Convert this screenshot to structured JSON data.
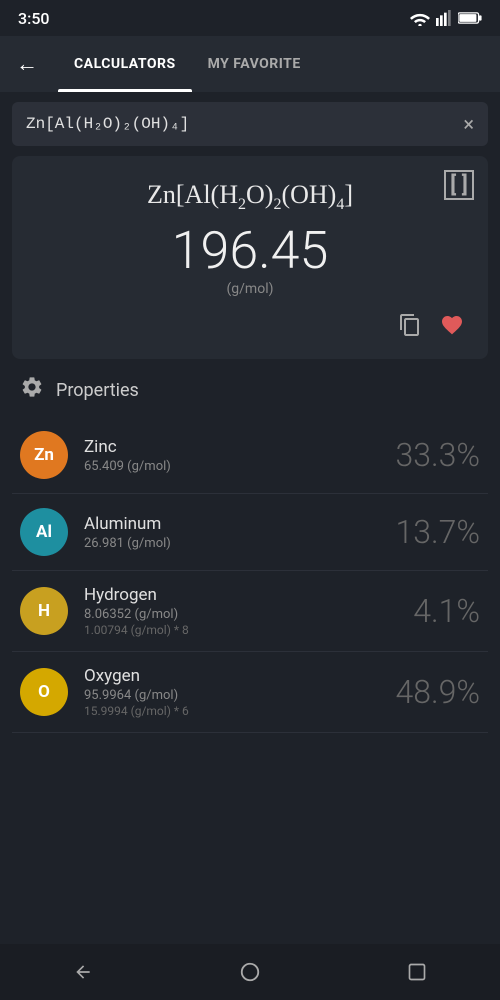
{
  "statusBar": {
    "time": "3:50"
  },
  "nav": {
    "tab1": "CALCULATORS",
    "tab2": "MY FAVORITE"
  },
  "searchBar": {
    "formula": "Zn[Al(H₂O)₂(OH)₄]",
    "clearLabel": "×"
  },
  "result": {
    "formulaHtml": "Zn[Al(H₂O)₂(OH)₄]",
    "molarMass": "196.45",
    "unit": "(g/mol)",
    "bracketLabel": "[ ]"
  },
  "properties": {
    "title": "Properties"
  },
  "elements": [
    {
      "symbol": "Zn",
      "color": "#e07820",
      "name": "Zinc",
      "mass": "65.409 (g/mol)",
      "detail": "",
      "percent": "33.3%"
    },
    {
      "symbol": "Al",
      "color": "#1e8fa0",
      "name": "Aluminum",
      "mass": "26.981 (g/mol)",
      "detail": "",
      "percent": "13.7%"
    },
    {
      "symbol": "H",
      "color": "#c8a020",
      "name": "Hydrogen",
      "mass": "8.06352 (g/mol)",
      "detail": "1.00794 (g/mol) * 8",
      "percent": "4.1%"
    },
    {
      "symbol": "O",
      "color": "#d4a800",
      "name": "Oxygen",
      "mass": "95.9964 (g/mol)",
      "detail": "15.9994 (g/mol) * 6",
      "percent": "48.9%"
    }
  ]
}
